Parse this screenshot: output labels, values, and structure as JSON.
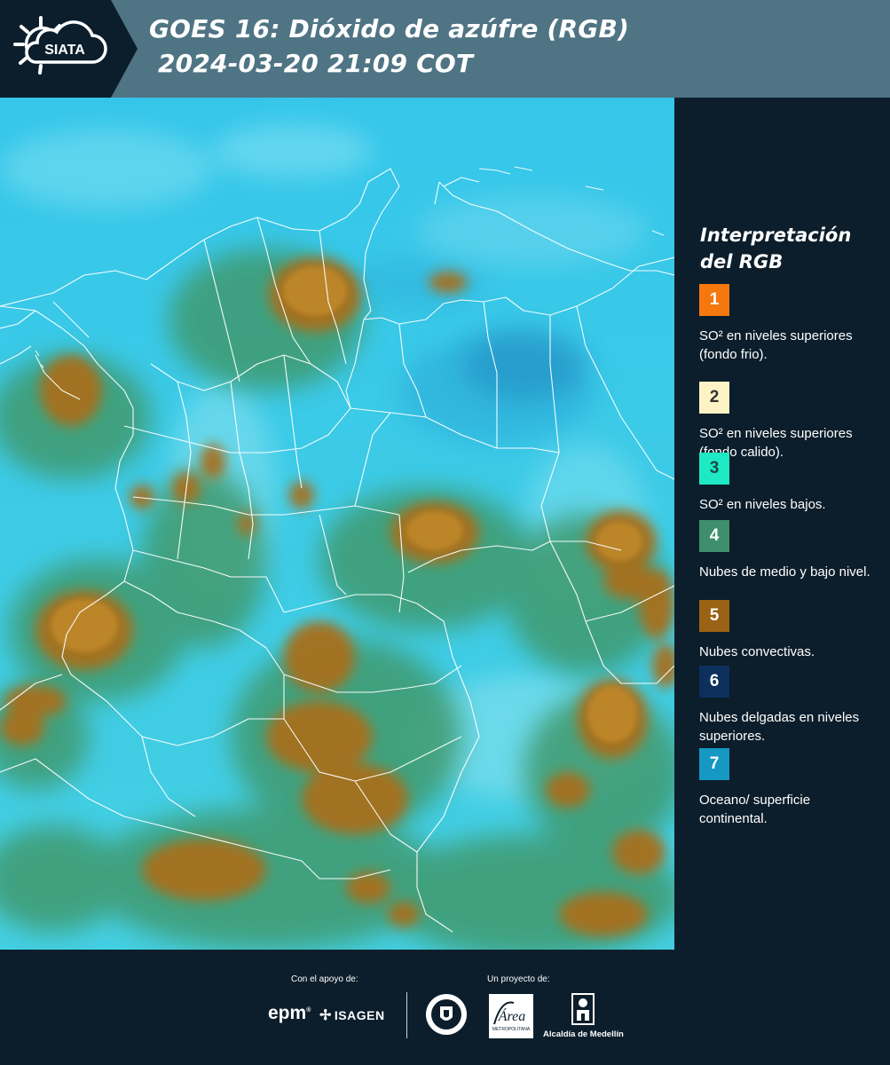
{
  "header": {
    "logo_text": "SIATA",
    "title_line1": "GOES 16: Dióxido de azúfre (RGB)",
    "title_line2": "2024-03-20 21:09 COT"
  },
  "legend": {
    "title": "Interpretación del RGB",
    "items": [
      {
        "number": "1",
        "color": "#f5780f",
        "text_color": "#ffffff",
        "description": "SO² en niveles superiores (fondo frio)."
      },
      {
        "number": "2",
        "color": "#fdf3c4",
        "text_color": "#333333",
        "description": "SO² en niveles superiores (fondo calido)."
      },
      {
        "number": "3",
        "color": "#1de9c5",
        "text_color": "#1a4a44",
        "description": "SO² en niveles bajos."
      },
      {
        "number": "4",
        "color": "#3f8f6c",
        "text_color": "#ffffff",
        "description": "Nubes de medio y bajo nivel."
      },
      {
        "number": "5",
        "color": "#9a6214",
        "text_color": "#ffffff",
        "description": "Nubes convectivas."
      },
      {
        "number": "6",
        "color": "#0c2f5c",
        "text_color": "#ffffff",
        "description": "Nubes delgadas en niveles superiores."
      },
      {
        "number": "7",
        "color": "#1598c4",
        "text_color": "#ffffff",
        "description": "Oceano/ superficie continental."
      }
    ]
  },
  "footer": {
    "support_label": "Con el apoyo de:",
    "project_label": "Un proyecto de:",
    "sponsor_epm": "epm",
    "sponsor_isagen": "ISAGEN",
    "partner_area": "Área",
    "partner_area_sub": "METROPOLITANA",
    "partner_alcaldia": "Alcaldía de Medellín"
  },
  "colors": {
    "header_bg": "#4f7484",
    "dark_bg": "#0c1e2b",
    "background_cyan": "#39c8e8",
    "cloud_green": "#3f8f6c",
    "cloud_brown": "#9a6214",
    "border_white": "#ffffff"
  }
}
